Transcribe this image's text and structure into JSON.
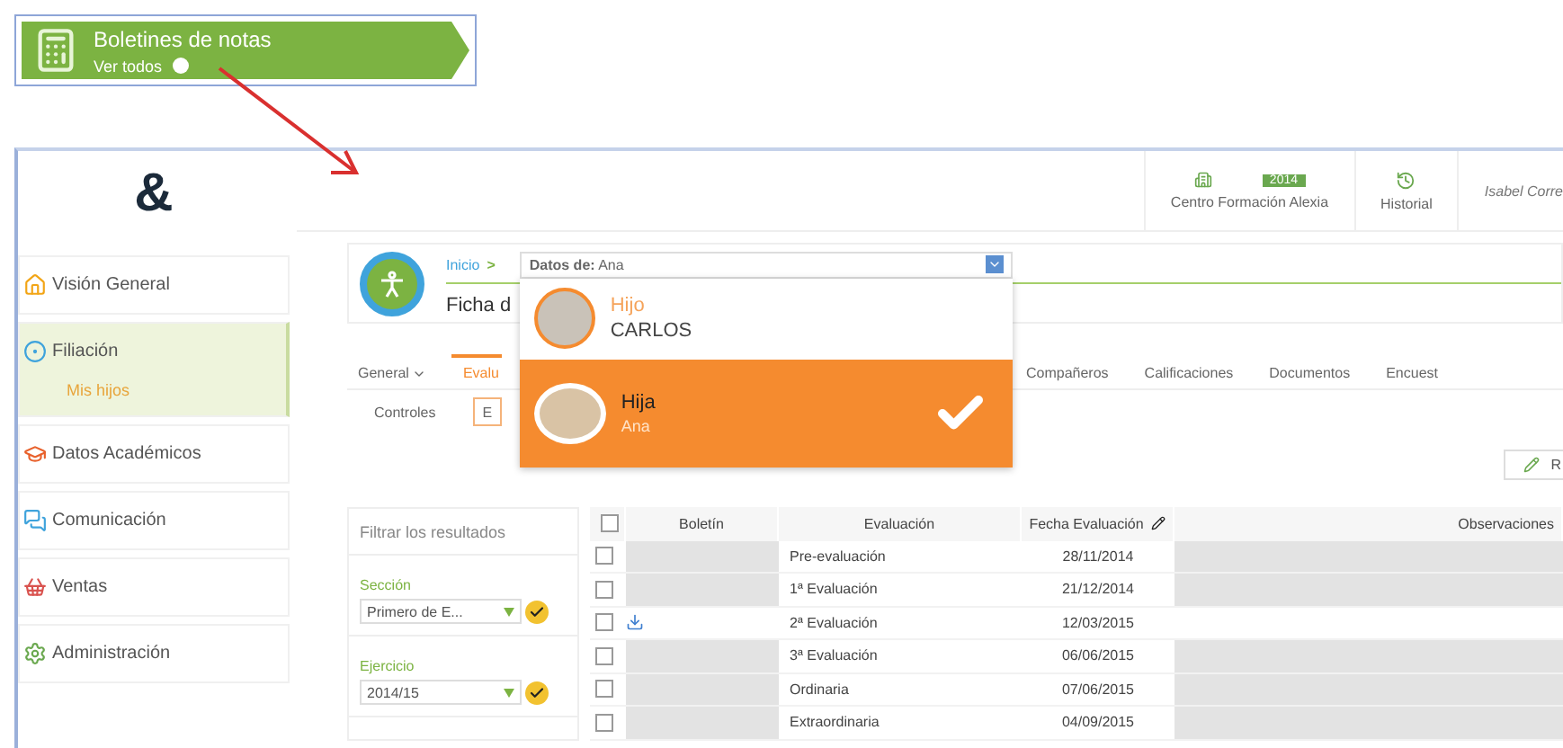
{
  "callout": {
    "title": "Boletines de notas",
    "link": "Ver todos"
  },
  "logo": "&",
  "sidebar": {
    "items": [
      {
        "label": "Visión General",
        "selected": false
      },
      {
        "label": "Filiación",
        "selected": true,
        "children": [
          {
            "label": "Mis hijos"
          }
        ]
      },
      {
        "label": "Datos Académicos",
        "selected": false
      },
      {
        "label": "Comunicación",
        "selected": false
      },
      {
        "label": "Ventas",
        "selected": false
      },
      {
        "label": "Administración",
        "selected": false
      }
    ]
  },
  "header": {
    "center": "Centro Formación Alexia",
    "year": "2014",
    "history": "Historial",
    "user": "Isabel Corre"
  },
  "breadcrumb": {
    "home": "Inicio",
    "separator": ">",
    "field_label": "Datos de:",
    "field_value": "Ana",
    "page_title": "Ficha d"
  },
  "dropdown": [
    {
      "relation": "Hijo",
      "name": "CARLOS",
      "selected": false
    },
    {
      "relation": "Hija",
      "name": "Ana",
      "selected": true
    }
  ],
  "tabs": [
    {
      "label": "General",
      "caret": true,
      "selected": false
    },
    {
      "label": "Evalu",
      "caret": false,
      "selected": true
    },
    {
      "label": "Compañeros",
      "caret": false,
      "selected": false
    },
    {
      "label": "Calificaciones",
      "caret": false,
      "selected": false
    },
    {
      "label": "Documentos",
      "caret": false,
      "selected": false
    },
    {
      "label": "Encuest",
      "caret": false,
      "selected": false
    }
  ],
  "subtabs": [
    {
      "label": "Controles",
      "selected": false
    },
    {
      "label": "E",
      "selected": true
    }
  ],
  "toolbar_button": "R",
  "filter": {
    "placeholder": "Filtrar los resultados",
    "fields": [
      {
        "label": "Sección",
        "value": "Primero de E..."
      },
      {
        "label": "Ejercicio",
        "value": "2014/15"
      }
    ]
  },
  "table": {
    "header_checked": false,
    "columns": [
      "Boletín",
      "Evaluación",
      "Fecha Evaluación",
      "Observaciones"
    ],
    "rows": [
      {
        "evaluacion": "Pre-evaluación",
        "fecha": "28/11/2014",
        "checked": false,
        "has_boletin": false
      },
      {
        "evaluacion": "1ª Evaluación",
        "fecha": "21/12/2014",
        "checked": false,
        "has_boletin": false
      },
      {
        "evaluacion": "2ª Evaluación",
        "fecha": "12/03/2015",
        "checked": false,
        "has_boletin": true
      },
      {
        "evaluacion": "3ª Evaluación",
        "fecha": "06/06/2015",
        "checked": false,
        "has_boletin": false
      },
      {
        "evaluacion": "Ordinaria",
        "fecha": "07/06/2015",
        "checked": false,
        "has_boletin": false
      },
      {
        "evaluacion": "Extraordinaria",
        "fecha": "04/09/2015",
        "checked": false,
        "has_boletin": false
      }
    ]
  }
}
